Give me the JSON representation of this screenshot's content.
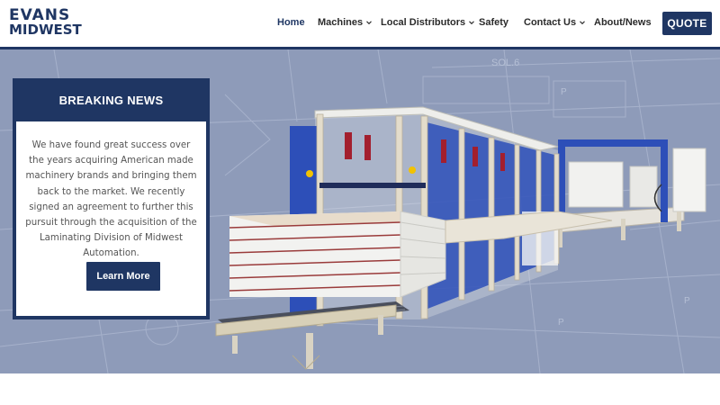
{
  "brand": {
    "line1": "EVANS",
    "line2": "MIDWEST"
  },
  "nav": {
    "items": [
      {
        "label": "Home",
        "active": true,
        "dropdown": false
      },
      {
        "label": "Machines",
        "active": false,
        "dropdown": true
      },
      {
        "label": "Local Distributors",
        "active": false,
        "dropdown": true
      },
      {
        "label": "Safety",
        "active": false,
        "dropdown": false
      },
      {
        "label": "Contact Us",
        "active": false,
        "dropdown": true
      },
      {
        "label": "About/News",
        "active": false,
        "dropdown": false
      }
    ],
    "quote_label": "QUOTE"
  },
  "hero": {
    "blueprint_label": "SOL.6",
    "blueprint_marks": [
      "P",
      "P",
      "P"
    ]
  },
  "news": {
    "title": "BREAKING NEWS",
    "body": "We have found great success over the years acquiring American made machinery brands and bringing them back to the market. We recently signed an agreement to further this pursuit through the acquisition of the Laminating Division of Midwest Automation.",
    "button_label": "Learn More"
  },
  "colors": {
    "brand_navy": "#1f3663",
    "hero_bg": "#8e9bb9",
    "machine_blue": "#2d4fb8",
    "text_gray": "#555555"
  }
}
